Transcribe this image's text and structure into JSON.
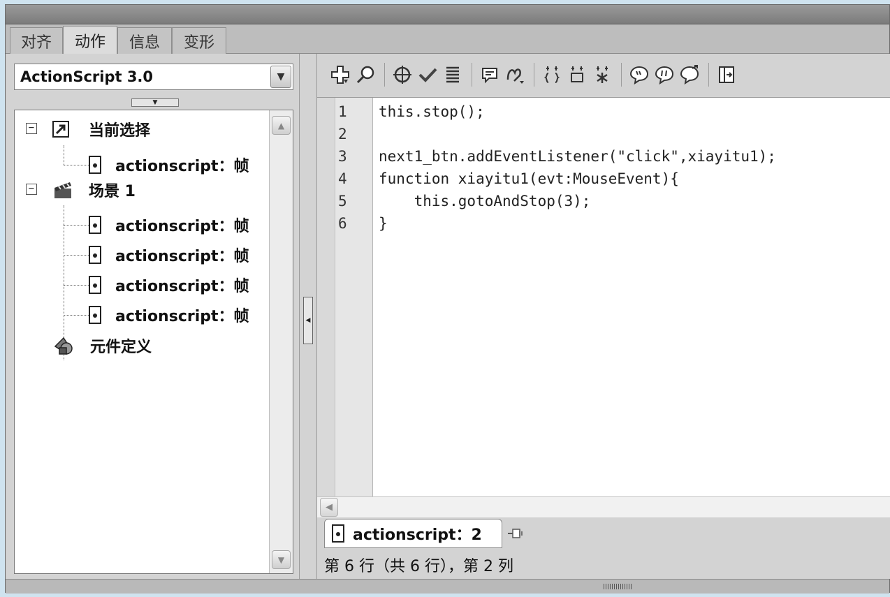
{
  "tabs": [
    {
      "label": "对齐",
      "active": false
    },
    {
      "label": "动作",
      "active": true
    },
    {
      "label": "信息",
      "active": false
    },
    {
      "label": "变形",
      "active": false
    }
  ],
  "language_select": {
    "value": "ActionScript 3.0"
  },
  "tree": {
    "current_selection": {
      "label": "当前选择",
      "icon": "arrow-cursor-icon",
      "items": [
        "actionscript：帧"
      ]
    },
    "scene": {
      "label": "场景 1",
      "icon": "clapperboard-icon",
      "items": [
        "actionscript：帧",
        "actionscript：帧",
        "actionscript：帧",
        "actionscript：帧"
      ]
    },
    "symbols": {
      "label": "元件定义",
      "icon": "symbols-icon"
    }
  },
  "toolbar": {
    "icons": [
      "add-statement-icon",
      "find-icon",
      "target-path-icon",
      "check-syntax-icon",
      "auto-format-icon",
      "code-hint-icon",
      "debug-options-icon",
      "collapse-between-braces-icon",
      "collapse-selection-icon",
      "expand-all-icon",
      "apply-block-comment-icon",
      "apply-line-comment-icon",
      "remove-comment-icon",
      "show-hide-toolbox-icon"
    ]
  },
  "editor": {
    "line_numbers": [
      "1",
      "2",
      "3",
      "4",
      "5",
      "6"
    ],
    "lines": [
      "this.stop();",
      "",
      "next1_btn.addEventListener(\"click\",xiayitu1);",
      "function xiayitu1(evt:MouseEvent){",
      "    this.gotoAndStop(3);",
      "}"
    ]
  },
  "script_tab": {
    "label": "actionscript：2"
  },
  "status_bar": {
    "text": "第 6 行（共 6 行），第 2 列"
  }
}
